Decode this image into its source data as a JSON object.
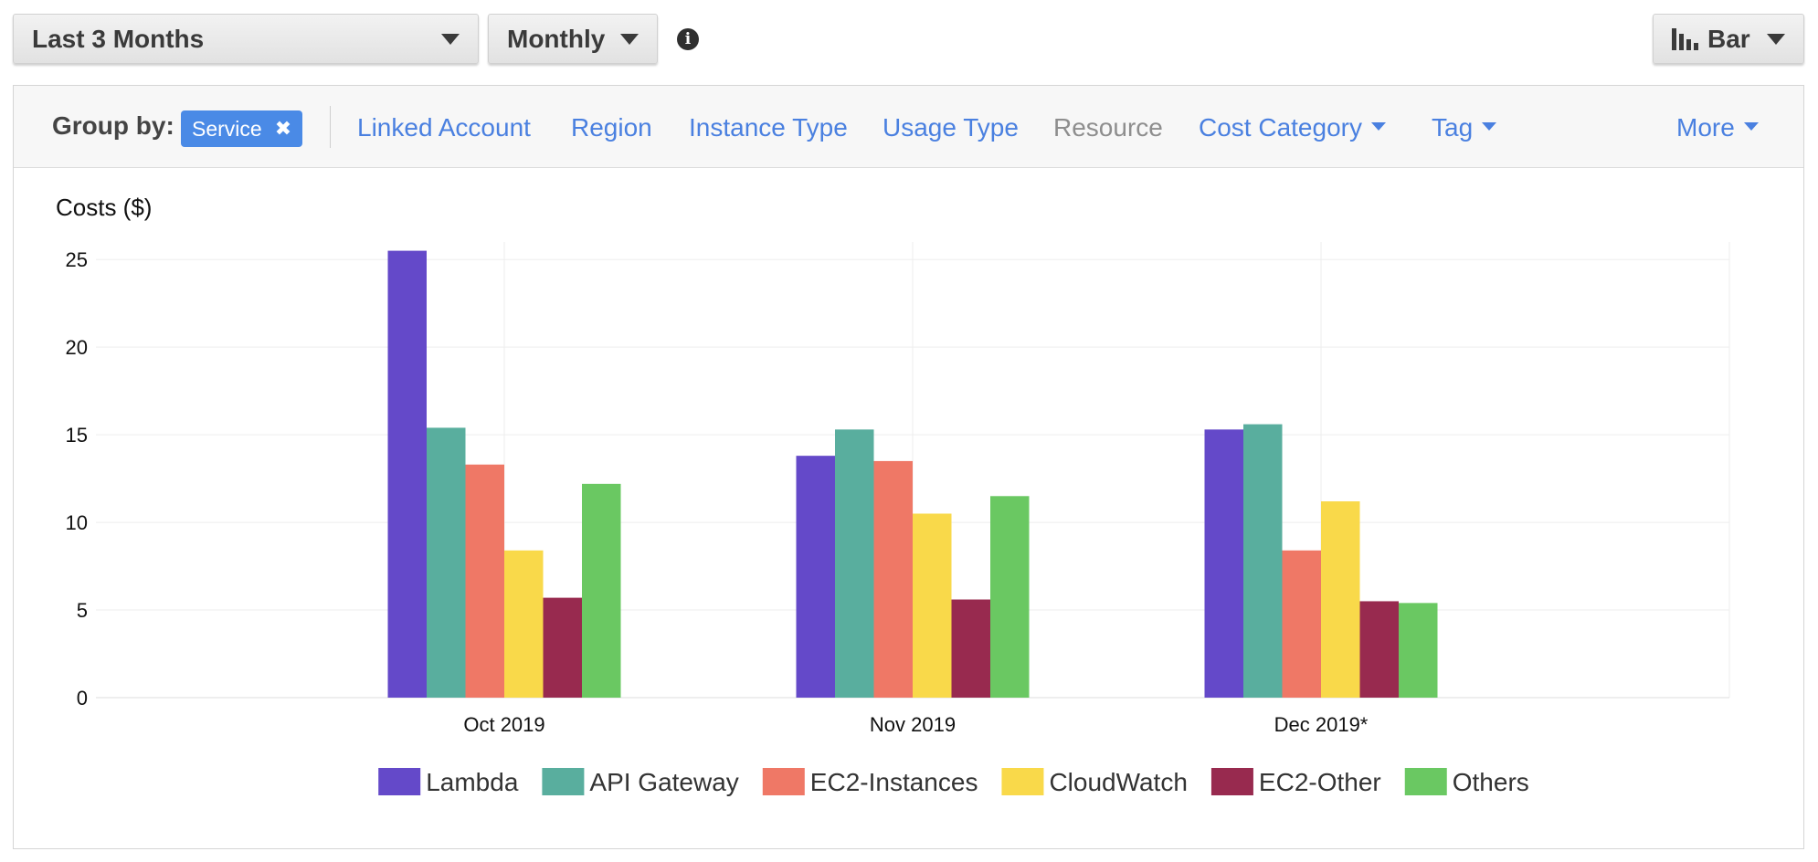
{
  "toolbar": {
    "range_label": "Last 3 Months",
    "granularity_label": "Monthly",
    "info_glyph": "i",
    "chart_type_label": "Bar"
  },
  "group_by": {
    "label": "Group by:",
    "selected": "Service",
    "selected_remove": "✖",
    "options": [
      {
        "label": "Linked Account",
        "enabled": true,
        "dropdown": false
      },
      {
        "label": "Region",
        "enabled": true,
        "dropdown": false
      },
      {
        "label": "Instance Type",
        "enabled": true,
        "dropdown": false
      },
      {
        "label": "Usage Type",
        "enabled": true,
        "dropdown": false
      },
      {
        "label": "Resource",
        "enabled": false,
        "dropdown": false
      },
      {
        "label": "Cost Category",
        "enabled": true,
        "dropdown": true
      },
      {
        "label": "Tag",
        "enabled": true,
        "dropdown": true
      }
    ],
    "more_label": "More"
  },
  "chart_data": {
    "type": "bar",
    "ylabel": "Costs ($)",
    "xlabel": "",
    "title": "",
    "ylim": [
      0,
      26
    ],
    "yticks": [
      0,
      5,
      10,
      15,
      20,
      25
    ],
    "grid": true,
    "legend_position": "bottom",
    "categories": [
      "Oct 2019",
      "Nov 2019",
      "Dec 2019*"
    ],
    "series": [
      {
        "name": "Lambda",
        "color": "#6449c9",
        "values": [
          25.5,
          13.8,
          15.3
        ]
      },
      {
        "name": "API Gateway",
        "color": "#59ae9e",
        "values": [
          15.4,
          15.3,
          15.6
        ]
      },
      {
        "name": "EC2-Instances",
        "color": "#ef7866",
        "values": [
          13.3,
          13.5,
          8.4
        ]
      },
      {
        "name": "CloudWatch",
        "color": "#f9d94a",
        "values": [
          8.4,
          10.5,
          11.2
        ]
      },
      {
        "name": "EC2-Other",
        "color": "#982a4f",
        "values": [
          5.7,
          5.6,
          5.5
        ]
      },
      {
        "name": "Others",
        "color": "#6ac862",
        "values": [
          12.2,
          11.5,
          5.4
        ]
      }
    ]
  }
}
